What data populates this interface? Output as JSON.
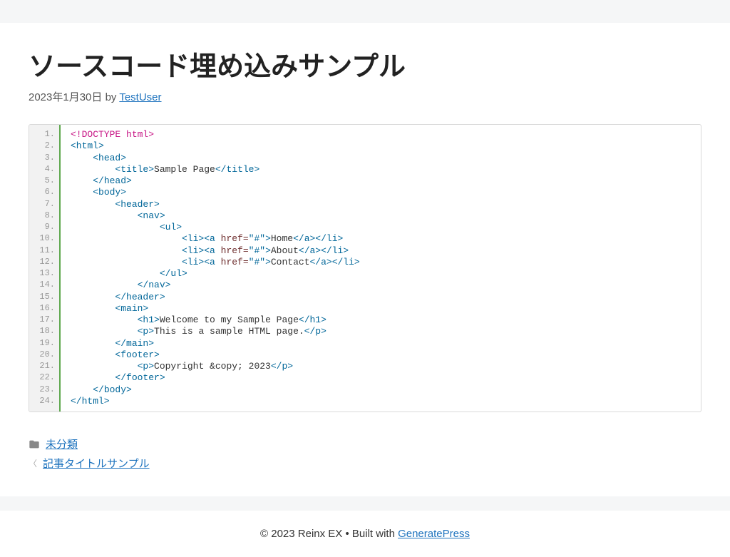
{
  "post": {
    "title": "ソースコード埋め込みサンプル",
    "date": "2023年1月30日",
    "by": "by",
    "author": "TestUser"
  },
  "code": {
    "lines": [
      {
        "n": "1.",
        "segs": [
          {
            "c": "t-doctype",
            "t": "<!DOCTYPE html>"
          }
        ]
      },
      {
        "n": "2.",
        "segs": [
          {
            "c": "t-tag",
            "t": "<html>"
          }
        ]
      },
      {
        "n": "3.",
        "segs": [
          {
            "c": "t-text",
            "t": "    "
          },
          {
            "c": "t-tag",
            "t": "<head>"
          }
        ]
      },
      {
        "n": "4.",
        "segs": [
          {
            "c": "t-text",
            "t": "        "
          },
          {
            "c": "t-tag",
            "t": "<title>"
          },
          {
            "c": "t-text",
            "t": "Sample Page"
          },
          {
            "c": "t-tag",
            "t": "</title>"
          }
        ]
      },
      {
        "n": "5.",
        "segs": [
          {
            "c": "t-text",
            "t": "    "
          },
          {
            "c": "t-tag",
            "t": "</head>"
          }
        ]
      },
      {
        "n": "6.",
        "segs": [
          {
            "c": "t-text",
            "t": "    "
          },
          {
            "c": "t-tag",
            "t": "<body>"
          }
        ]
      },
      {
        "n": "7.",
        "segs": [
          {
            "c": "t-text",
            "t": "        "
          },
          {
            "c": "t-tag",
            "t": "<header>"
          }
        ]
      },
      {
        "n": "8.",
        "segs": [
          {
            "c": "t-text",
            "t": "            "
          },
          {
            "c": "t-tag",
            "t": "<nav>"
          }
        ]
      },
      {
        "n": "9.",
        "segs": [
          {
            "c": "t-text",
            "t": "                "
          },
          {
            "c": "t-tag",
            "t": "<ul>"
          }
        ]
      },
      {
        "n": "10.",
        "segs": [
          {
            "c": "t-text",
            "t": "                    "
          },
          {
            "c": "t-tag",
            "t": "<li><a "
          },
          {
            "c": "t-attr",
            "t": "href="
          },
          {
            "c": "t-str",
            "t": "\"#\""
          },
          {
            "c": "t-tag",
            "t": ">"
          },
          {
            "c": "t-text",
            "t": "Home"
          },
          {
            "c": "t-tag",
            "t": "</a></li>"
          }
        ]
      },
      {
        "n": "11.",
        "segs": [
          {
            "c": "t-text",
            "t": "                    "
          },
          {
            "c": "t-tag",
            "t": "<li><a "
          },
          {
            "c": "t-attr",
            "t": "href="
          },
          {
            "c": "t-str",
            "t": "\"#\""
          },
          {
            "c": "t-tag",
            "t": ">"
          },
          {
            "c": "t-text",
            "t": "About"
          },
          {
            "c": "t-tag",
            "t": "</a></li>"
          }
        ]
      },
      {
        "n": "12.",
        "segs": [
          {
            "c": "t-text",
            "t": "                    "
          },
          {
            "c": "t-tag",
            "t": "<li><a "
          },
          {
            "c": "t-attr",
            "t": "href="
          },
          {
            "c": "t-str",
            "t": "\"#\""
          },
          {
            "c": "t-tag",
            "t": ">"
          },
          {
            "c": "t-text",
            "t": "Contact"
          },
          {
            "c": "t-tag",
            "t": "</a></li>"
          }
        ]
      },
      {
        "n": "13.",
        "segs": [
          {
            "c": "t-text",
            "t": "                "
          },
          {
            "c": "t-tag",
            "t": "</ul>"
          }
        ]
      },
      {
        "n": "14.",
        "segs": [
          {
            "c": "t-text",
            "t": "            "
          },
          {
            "c": "t-tag",
            "t": "</nav>"
          }
        ]
      },
      {
        "n": "15.",
        "segs": [
          {
            "c": "t-text",
            "t": "        "
          },
          {
            "c": "t-tag",
            "t": "</header>"
          }
        ]
      },
      {
        "n": "16.",
        "segs": [
          {
            "c": "t-text",
            "t": "        "
          },
          {
            "c": "t-tag",
            "t": "<main>"
          }
        ]
      },
      {
        "n": "17.",
        "segs": [
          {
            "c": "t-text",
            "t": "            "
          },
          {
            "c": "t-tag",
            "t": "<h1>"
          },
          {
            "c": "t-text",
            "t": "Welcome to my Sample Page"
          },
          {
            "c": "t-tag",
            "t": "</h1>"
          }
        ]
      },
      {
        "n": "18.",
        "segs": [
          {
            "c": "t-text",
            "t": "            "
          },
          {
            "c": "t-tag",
            "t": "<p>"
          },
          {
            "c": "t-text",
            "t": "This is a sample HTML page."
          },
          {
            "c": "t-tag",
            "t": "</p>"
          }
        ]
      },
      {
        "n": "19.",
        "segs": [
          {
            "c": "t-text",
            "t": "        "
          },
          {
            "c": "t-tag",
            "t": "</main>"
          }
        ]
      },
      {
        "n": "20.",
        "segs": [
          {
            "c": "t-text",
            "t": "        "
          },
          {
            "c": "t-tag",
            "t": "<footer>"
          }
        ]
      },
      {
        "n": "21.",
        "segs": [
          {
            "c": "t-text",
            "t": "            "
          },
          {
            "c": "t-tag",
            "t": "<p>"
          },
          {
            "c": "t-text",
            "t": "Copyright &copy; 2023"
          },
          {
            "c": "t-tag",
            "t": "</p>"
          }
        ]
      },
      {
        "n": "22.",
        "segs": [
          {
            "c": "t-text",
            "t": "        "
          },
          {
            "c": "t-tag",
            "t": "</footer>"
          }
        ]
      },
      {
        "n": "23.",
        "segs": [
          {
            "c": "t-text",
            "t": "    "
          },
          {
            "c": "t-tag",
            "t": "</body>"
          }
        ]
      },
      {
        "n": "24.",
        "segs": [
          {
            "c": "t-tag",
            "t": "</html>"
          }
        ]
      }
    ]
  },
  "footer_meta": {
    "category": "未分類",
    "prev_post": "記事タイトルサンプル"
  },
  "site_footer": {
    "copyright_prefix": "© 2023 Reinx EX • Built with ",
    "builder": "GeneratePress"
  }
}
